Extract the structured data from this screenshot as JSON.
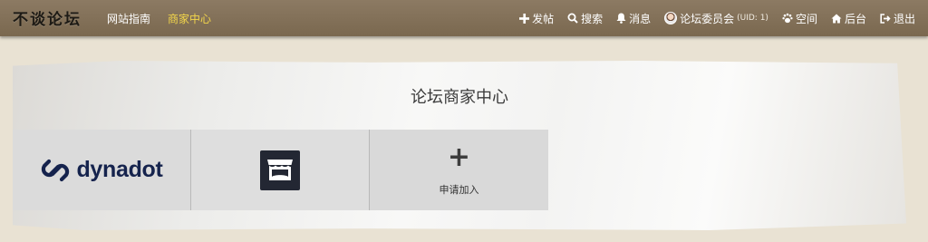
{
  "header": {
    "logo_text": "不谈论坛",
    "nav_links": [
      {
        "label": "网站指南",
        "active": false
      },
      {
        "label": "商家中心",
        "active": true
      }
    ],
    "right_items": {
      "post": "发帖",
      "search": "搜索",
      "messages": "消息",
      "user_name": "论坛委员会",
      "user_uid": "(UID: 1)",
      "space": "空间",
      "admin": "后台",
      "logout": "退出"
    },
    "colors": {
      "bar": "#85725a",
      "active_link": "#f3d64a"
    }
  },
  "main": {
    "title": "论坛商家中心",
    "merchants": [
      {
        "name": "dynadot",
        "icon": "dynadot-logo-icon"
      },
      {
        "icon": "store-icon"
      }
    ],
    "apply": {
      "icon": "plus-icon",
      "label": "申请加入"
    }
  }
}
